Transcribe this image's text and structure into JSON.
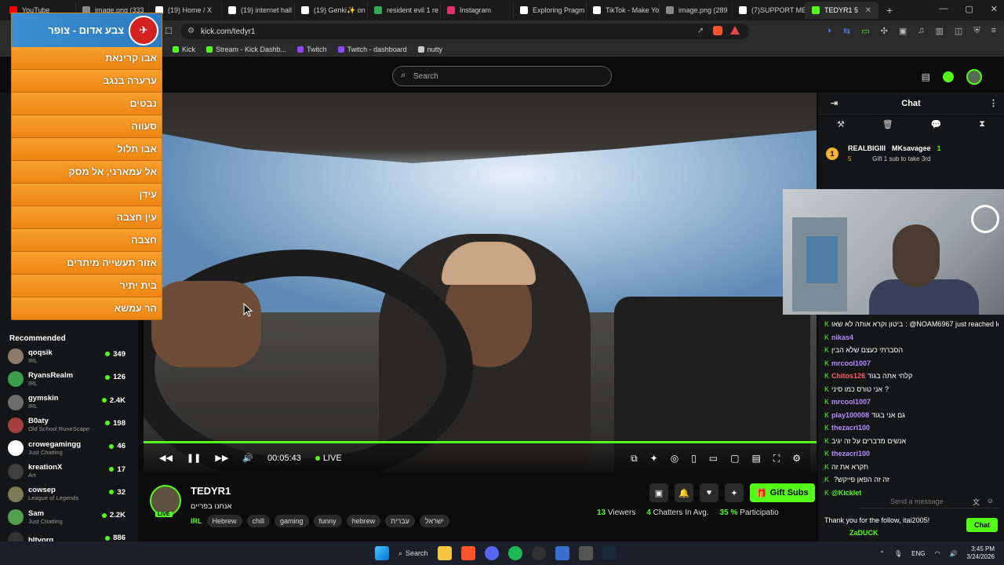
{
  "browser": {
    "tabs": [
      {
        "label": "YouTube",
        "color": "#ff0000"
      },
      {
        "label": "image.png (333",
        "color": "#888888"
      },
      {
        "label": "(19) Home / X",
        "color": "#ffffff"
      },
      {
        "label": "(19) internet hall",
        "color": "#ffffff"
      },
      {
        "label": "(19) Genki✨ on",
        "color": "#ffffff"
      },
      {
        "label": "resident evil 1 re",
        "color": "#34a853"
      },
      {
        "label": "Instagram",
        "color": "#e1306c"
      },
      {
        "label": "Exploring Pragm",
        "color": "#ffffff"
      },
      {
        "label": "TikTok - Make Yo",
        "color": "#ffffff"
      },
      {
        "label": "image.png (289",
        "color": "#888888"
      },
      {
        "label": "(7)SUPPORT ME",
        "color": "#ffffff"
      },
      {
        "label": "TEDYR1 5",
        "color": "#53fc18",
        "active": true
      }
    ],
    "url": "kick.com/tedyr1",
    "bookmarks": [
      {
        "label": "Kick",
        "color": "#53fc18"
      },
      {
        "label": "Stream - Kick Dashb...",
        "color": "#53fc18"
      },
      {
        "label": "Twitch",
        "color": "#9146ff"
      },
      {
        "label": "Twitch - dashboard",
        "color": "#9146ff"
      },
      {
        "label": "nutty",
        "color": "#cccccc"
      }
    ]
  },
  "header": {
    "search_placeholder": "Search"
  },
  "alert": {
    "title": "צבע אדום - צופר",
    "rows": [
      "אבו קרינאת",
      "ערערה בנגב",
      "נבטים",
      "סעווה",
      "אבו תלול",
      "אל עמארני, אל מסק",
      "עידן",
      "עין חצבה",
      "חצבה",
      "אזור תעשייה מיתרים",
      "בית יתיר",
      "הר עמשא"
    ]
  },
  "sidebar": {
    "recommended_title": "Recommended",
    "channels": [
      {
        "name": "qoqsik",
        "category": "IRL",
        "viewers": "349",
        "color": "#8c7b6a"
      },
      {
        "name": "RyansRealm",
        "category": "IRL",
        "viewers": "126",
        "color": "#3a9e4a"
      },
      {
        "name": "gymskin",
        "category": "IRL",
        "viewers": "2.4K",
        "color": "#6c6c6c"
      },
      {
        "name": "B0aty",
        "category": "Old School RuneScape",
        "viewers": "198",
        "color": "#a04040"
      },
      {
        "name": "crowegamingg",
        "category": "Just Chatting",
        "viewers": "46",
        "color": "#ffffff"
      },
      {
        "name": "kreationX",
        "category": "Art",
        "viewers": "17",
        "color": "#404040"
      },
      {
        "name": "cowsep",
        "category": "League of Legends",
        "viewers": "32",
        "color": "#7a7a55"
      },
      {
        "name": "Sam",
        "category": "Just Chatting",
        "viewers": "2.2K",
        "color": "#53a04f"
      },
      {
        "name": "hltvorg",
        "category": "",
        "viewers": "886",
        "color": "#333333"
      }
    ]
  },
  "player": {
    "time": "00:05:43",
    "live_label": "LIVE",
    "progress": 1.0
  },
  "stream": {
    "streamer": "TEDYR1",
    "live_badge": "LIVE",
    "title": "אנחנו בפריים",
    "category": "IRL",
    "tags": [
      "Hebrew",
      "chill",
      "gaming",
      "funny",
      "hebrew",
      "עברית",
      "ישראל"
    ],
    "gift_label": "Gift Subs",
    "viewers": "13",
    "viewers_label": "Viewers",
    "chatters": "4",
    "chatters_label": "Chatters In Avg.",
    "participation": "35 %",
    "participation_label": "Participatio"
  },
  "chat": {
    "title": "Chat",
    "pinned": {
      "user1": "REALBIGIII",
      "user1_count": "5",
      "user2": "MKsavagee",
      "user2_count": "1",
      "note": "Gift 1 sub to take 3rd",
      "badge": "1"
    },
    "messages": [
      {
        "user": "",
        "text": "ביטון וקרא אותה לא שאו: @NOAM6967 just reached level",
        "color": "#ffffff"
      },
      {
        "user": "nikas4",
        "text": "",
        "color": "#b58cff"
      },
      {
        "user": "",
        "text": "הסברתי כעצם שלא הבין",
        "color": "#ffffff"
      },
      {
        "user": "mrcool1007",
        "text": "",
        "color": "#b58cff"
      },
      {
        "user": "Chitos126",
        "text": "קלחי אתה בגוד",
        "color": "#ff5c5c"
      },
      {
        "user": "",
        "text": "אני טורס כמו סיני?",
        "color": "#ffffff"
      },
      {
        "user": "mrcool1007",
        "text": "",
        "color": "#b58cff"
      },
      {
        "user": "play100008",
        "text": "גם אני בגוד",
        "color": "#b58cff"
      },
      {
        "user": "thezacri100",
        "text": "",
        "color": "#b58cff"
      },
      {
        "user": "",
        "text": "אנשים מדברים על זה יגיב",
        "color": "#ffffff"
      },
      {
        "user": "thezacri100",
        "text": "",
        "color": "#b58cff"
      },
      {
        "user": "",
        "text": "תקרא את זה",
        "color": "#ffffff"
      },
      {
        "user": "",
        "text": "?זה זה הפאן פייקש",
        "color": "#ffffff"
      },
      {
        "user": "@Kicklet",
        "text": "",
        "color": "#53fc18"
      }
    ],
    "input_placeholder": "Send a message",
    "thanks_line": "Thank you for the follow, itai2005!",
    "last_user": "ZaDUCK",
    "send_label": "Chat"
  },
  "taskbar": {
    "search_label": "Search",
    "lang": "ENG",
    "time": "3:45 PM",
    "date": "3/24/2026"
  },
  "colors": {
    "kick_green": "#53fc18",
    "alert_orange": "#f7931a"
  }
}
